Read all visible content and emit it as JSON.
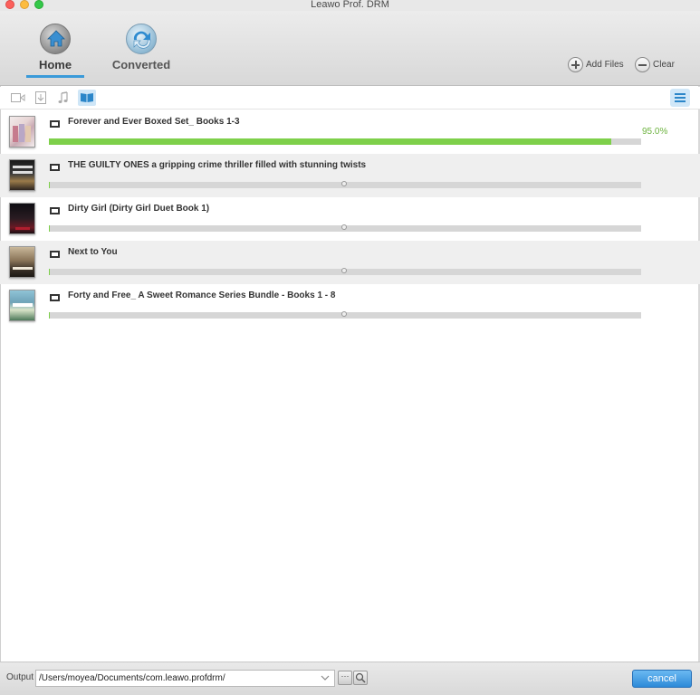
{
  "window": {
    "title": "Leawo Prof. DRM"
  },
  "toolbar": {
    "home_label": "Home",
    "converted_label": "Converted",
    "add_files_label": "Add Files",
    "clear_label": "Clear"
  },
  "filters": {
    "items": [
      {
        "icon": "video-icon"
      },
      {
        "icon": "document-icon"
      },
      {
        "icon": "music-icon"
      },
      {
        "icon": "ebook-icon",
        "active": true
      }
    ]
  },
  "files": [
    {
      "title": "Forever and Ever Boxed Set_ Books 1-3",
      "progress": 0.95,
      "progress_text": "95.0%"
    },
    {
      "title": "THE GUILTY ONES a gripping crime thriller filled with stunning twists",
      "progress": 0.0
    },
    {
      "title": "Dirty Girl (Dirty Girl Duet Book 1)",
      "progress": 0.0
    },
    {
      "title": "Next to You",
      "progress": 0.0
    },
    {
      "title": "Forty and Free_ A Sweet Romance Series Bundle - Books 1 - 8",
      "progress": 0.0
    }
  ],
  "bottom": {
    "output_label": "Output",
    "output_path": "/Users/moyea/Documents/com.leawo.profdrm/",
    "browse_label": "···",
    "cancel_label": "cancel"
  },
  "colors": {
    "accent": "#3a9ad9",
    "progress": "#7ed04a",
    "cancel_button": "#2d8ad8"
  }
}
